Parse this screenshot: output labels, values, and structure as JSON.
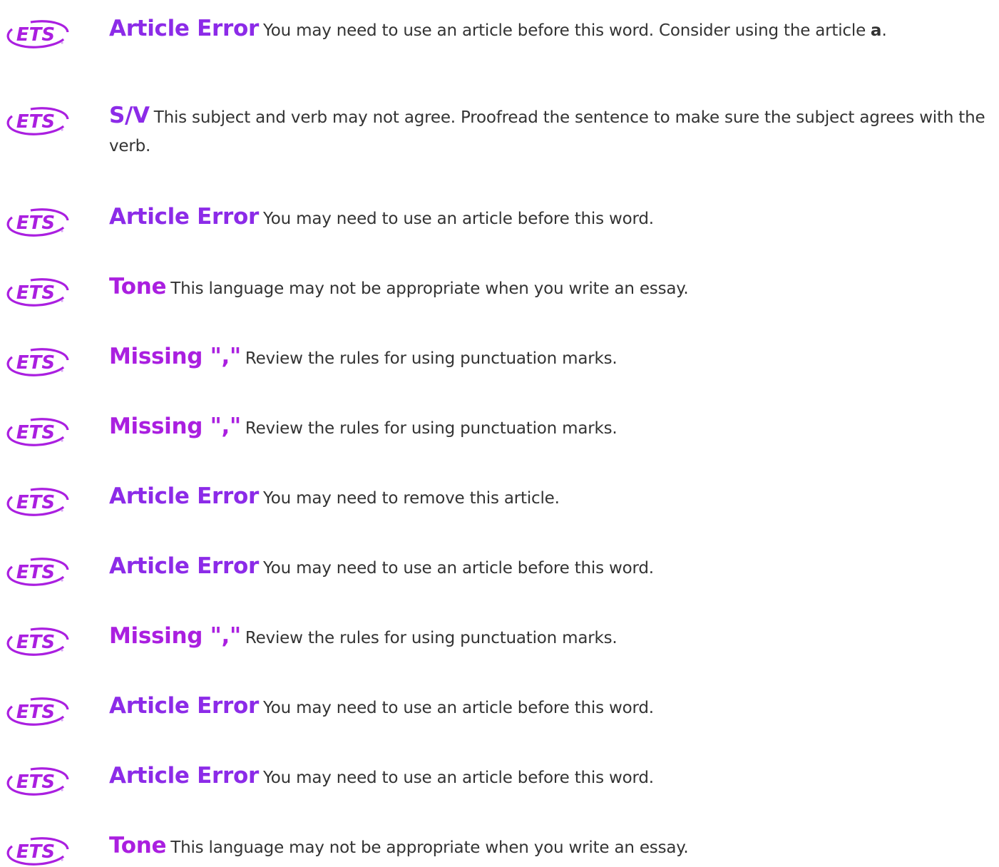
{
  "colors": {
    "purple": "#aa1fe0",
    "blue_purple": "#8c2be8",
    "text": "#333333"
  },
  "logo": {
    "text": "ETS",
    "icon": "ets-logo-icon"
  },
  "items": [
    {
      "category": "Article Error",
      "color": "#8c2be8",
      "message": "You may need to use an article before this word. Consider using the article",
      "suggestion": "a",
      "suffix": "."
    },
    {
      "category": "S/V",
      "color": "#8c2be8",
      "message": "This subject and verb may not agree. Proofread the sentence to make sure the subject agrees with the verb.",
      "suggestion": "",
      "suffix": ""
    },
    {
      "category": "Article Error",
      "color": "#8c2be8",
      "message": "You may need to use an article before this word.",
      "suggestion": "",
      "suffix": ""
    },
    {
      "category": "Tone",
      "color": "#aa1fe0",
      "message": "This language may not be appropriate when you write an essay.",
      "suggestion": "",
      "suffix": ""
    },
    {
      "category": "Missing \",\"",
      "color": "#aa1fe0",
      "message": "Review the rules for using punctuation marks.",
      "suggestion": "",
      "suffix": ""
    },
    {
      "category": "Missing \",\"",
      "color": "#aa1fe0",
      "message": "Review the rules for using punctuation marks.",
      "suggestion": "",
      "suffix": ""
    },
    {
      "category": "Article Error",
      "color": "#8c2be8",
      "message": "You may need to remove this article.",
      "suggestion": "",
      "suffix": ""
    },
    {
      "category": "Article Error",
      "color": "#8c2be8",
      "message": "You may need to use an article before this word.",
      "suggestion": "",
      "suffix": ""
    },
    {
      "category": "Missing \",\"",
      "color": "#aa1fe0",
      "message": "Review the rules for using punctuation marks.",
      "suggestion": "",
      "suffix": ""
    },
    {
      "category": "Article Error",
      "color": "#8c2be8",
      "message": "You may need to use an article before this word.",
      "suggestion": "",
      "suffix": ""
    },
    {
      "category": "Article Error",
      "color": "#8c2be8",
      "message": "You may need to use an article before this word.",
      "suggestion": "",
      "suffix": ""
    },
    {
      "category": "Tone",
      "color": "#aa1fe0",
      "message": "This language may not be appropriate when you write an essay.",
      "suggestion": "",
      "suffix": ""
    }
  ]
}
